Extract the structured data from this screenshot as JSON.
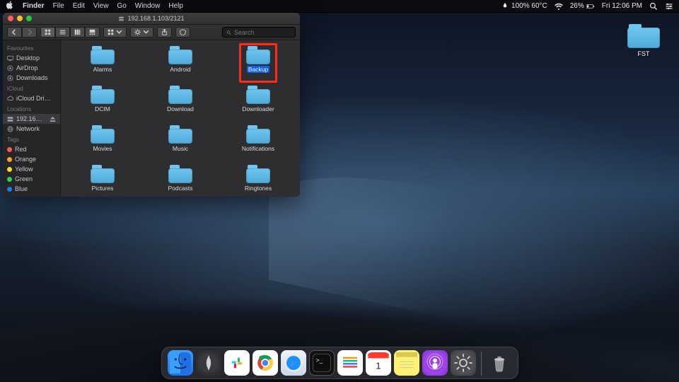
{
  "menubar": {
    "app_name": "Finder",
    "menus": [
      "File",
      "Edit",
      "View",
      "Go",
      "Window",
      "Help"
    ],
    "status": {
      "temp": "100% 60°C",
      "battery_pct": "26%",
      "clock": "Fri 12:06 PM"
    }
  },
  "desktop": {
    "items": [
      {
        "name": "FST"
      }
    ]
  },
  "finder": {
    "title": "192.168.1.103/2121",
    "search_placeholder": "Search",
    "sidebar": {
      "sections": [
        {
          "heading": "Favourites",
          "items": [
            {
              "icon": "desktop",
              "label": "Desktop"
            },
            {
              "icon": "airdrop",
              "label": "AirDrop"
            },
            {
              "icon": "downloads",
              "label": "Downloads"
            }
          ]
        },
        {
          "heading": "iCloud",
          "items": [
            {
              "icon": "cloud",
              "label": "iCloud Dri…"
            }
          ]
        },
        {
          "heading": "Locations",
          "items": [
            {
              "icon": "server",
              "label": "192.16…",
              "selected": true,
              "eject": true
            },
            {
              "icon": "globe",
              "label": "Network"
            }
          ]
        },
        {
          "heading": "Tags",
          "items": [
            {
              "color": "#ff5b56",
              "label": "Red"
            },
            {
              "color": "#ff9e2c",
              "label": "Orange"
            },
            {
              "color": "#ffd92e",
              "label": "Yellow"
            },
            {
              "color": "#30d158",
              "label": "Green"
            },
            {
              "color": "#0a84ff",
              "label": "Blue"
            }
          ]
        }
      ]
    },
    "items": [
      {
        "name": "Alarms"
      },
      {
        "name": "Android"
      },
      {
        "name": "Backup",
        "selected": true,
        "callout": true
      },
      {
        "name": "DCIM"
      },
      {
        "name": "Download"
      },
      {
        "name": "Downloader"
      },
      {
        "name": "Movies"
      },
      {
        "name": "Music"
      },
      {
        "name": "Notifications"
      },
      {
        "name": "Pictures"
      },
      {
        "name": "Podcasts"
      },
      {
        "name": "Ringtones"
      }
    ]
  },
  "dock": {
    "items": [
      {
        "id": "finder",
        "name": "Finder"
      },
      {
        "id": "launchpad",
        "name": "Launchpad"
      },
      {
        "id": "slack",
        "name": "Slack"
      },
      {
        "id": "chrome",
        "name": "Chrome"
      },
      {
        "id": "safari",
        "name": "Safari"
      },
      {
        "id": "terminal",
        "name": "Terminal"
      },
      {
        "id": "bars",
        "name": "App"
      },
      {
        "id": "calendar",
        "name": "Calendar",
        "day": "1"
      },
      {
        "id": "notes",
        "name": "Notes"
      },
      {
        "id": "podcasts",
        "name": "Podcasts"
      },
      {
        "id": "preferences",
        "name": "System Preferences"
      }
    ],
    "trash": "Trash"
  }
}
